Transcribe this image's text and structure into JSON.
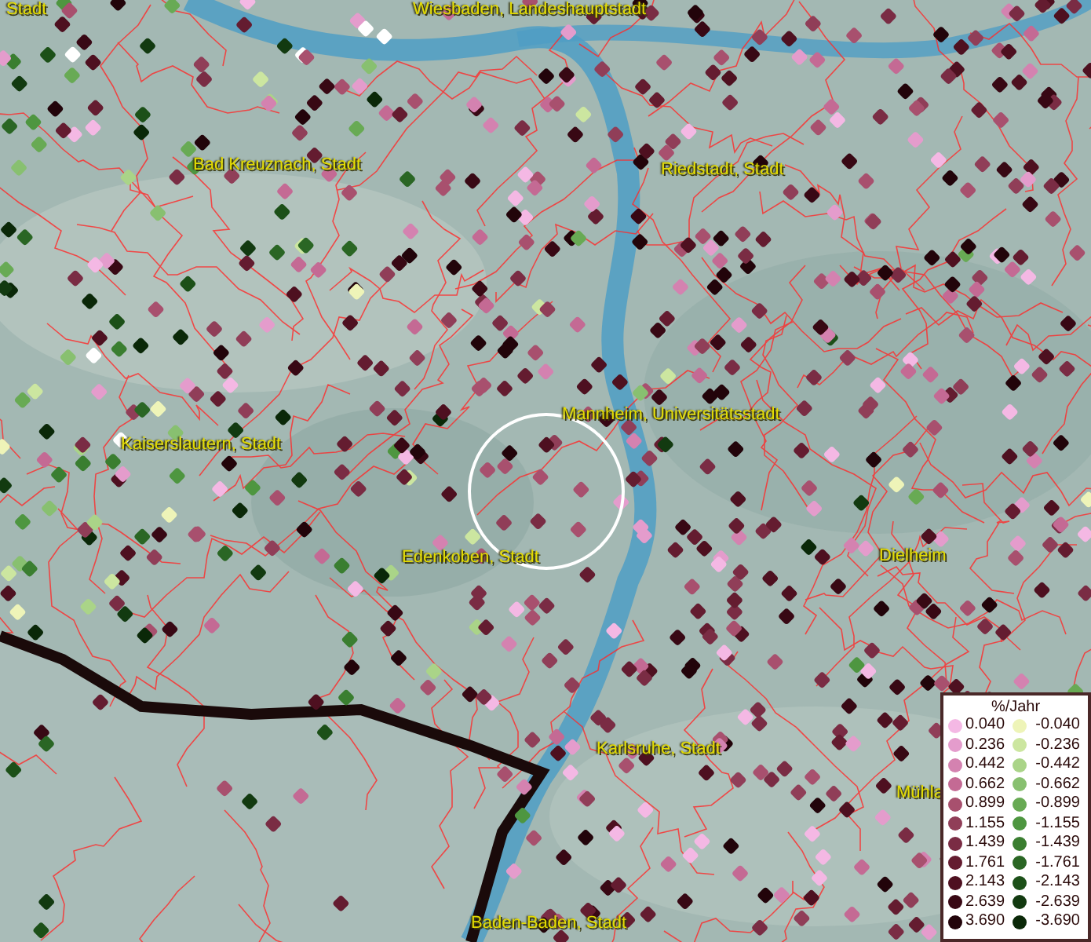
{
  "map": {
    "place_labels": [
      {
        "text": "Stadt"
      },
      {
        "text": "Wiesbaden, Landeshauptstadt"
      },
      {
        "text": "Bad Kreuznach, Stadt"
      },
      {
        "text": "Riedstadt, Stadt"
      },
      {
        "text": "Kaiserslautern, Stadt"
      },
      {
        "text": "Mannheim, Universitätsstadt"
      },
      {
        "text": "Edenkoben, Stadt"
      },
      {
        "text": "Dielheim"
      },
      {
        "text": "Karlsruhe, Stadt"
      },
      {
        "text": "Mühla"
      },
      {
        "text": "Baden-Baden, Stadt"
      }
    ]
  },
  "legend": {
    "title": "%/Jahr",
    "positive": [
      {
        "label": "0.040",
        "color": "#f4b8e4"
      },
      {
        "label": "0.236",
        "color": "#e49ccc"
      },
      {
        "label": "0.442",
        "color": "#d482b0"
      },
      {
        "label": "0.662",
        "color": "#c46a94"
      },
      {
        "label": "0.899",
        "color": "#a8506e"
      },
      {
        "label": "1.155",
        "color": "#903e58"
      },
      {
        "label": "1.439",
        "color": "#7a2c44"
      },
      {
        "label": "1.761",
        "color": "#641c30"
      },
      {
        "label": "2.143",
        "color": "#4e1020"
      },
      {
        "label": "2.639",
        "color": "#380814"
      },
      {
        "label": "3.690",
        "color": "#22040a"
      }
    ],
    "negative": [
      {
        "label": "-0.040",
        "color": "#eef4b8"
      },
      {
        "label": "-0.236",
        "color": "#cce6a0"
      },
      {
        "label": "-0.442",
        "color": "#aad488"
      },
      {
        "label": "-0.662",
        "color": "#88c070"
      },
      {
        "label": "-0.899",
        "color": "#68aa54"
      },
      {
        "label": "-1.155",
        "color": "#4e9640"
      },
      {
        "label": "-1.439",
        "color": "#3a7e30"
      },
      {
        "label": "-1.761",
        "color": "#2a6624"
      },
      {
        "label": "-2.143",
        "color": "#1c5018"
      },
      {
        "label": "-2.639",
        "color": "#123a10"
      },
      {
        "label": "-3.690",
        "color": "#0a2808"
      }
    ]
  }
}
